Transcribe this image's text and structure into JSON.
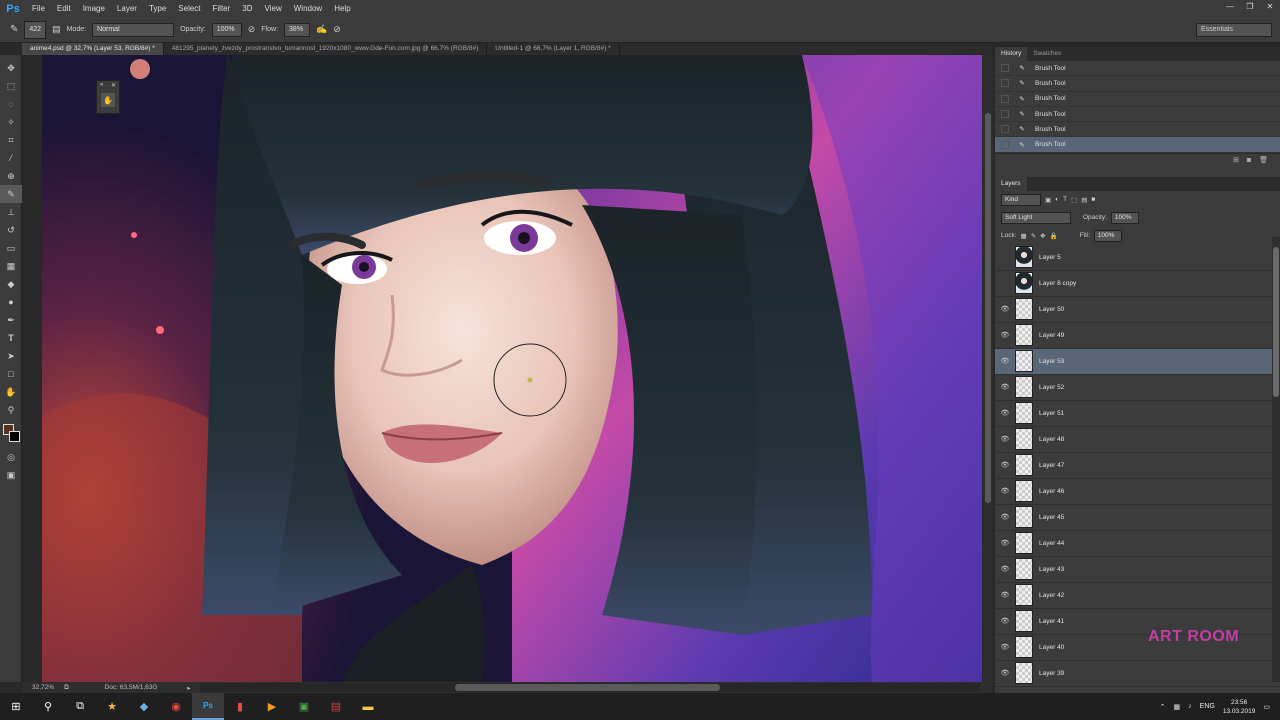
{
  "app": {
    "logo": "Ps"
  },
  "menu": [
    "File",
    "Edit",
    "Image",
    "Layer",
    "Type",
    "Select",
    "Filter",
    "3D",
    "View",
    "Window",
    "Help"
  ],
  "options": {
    "brush_size": "422",
    "mode_label": "Mode:",
    "mode_value": "Normal",
    "opacity_label": "Opacity:",
    "opacity_value": "100%",
    "flow_label": "Flow:",
    "flow_value": "38%",
    "workspace": "Essentials"
  },
  "tabs": [
    "anime4.psd @ 32,7% (Layer 53, RGB/8#) *",
    "481295_planety_zvezdy_prostranstvo_tumannost_1920x1080_www.Gde-Fon.com.jpg @ 66,7% (RGB/8#)",
    "Untitled-1 @ 66,7% (Layer 1, RGB/8#) *"
  ],
  "status": {
    "zoom": "32,72%",
    "doc": "Doc: 63,5M/1,63G"
  },
  "history": {
    "tabs": [
      "History",
      "Swatches"
    ],
    "items": [
      "Brush Tool",
      "Brush Tool",
      "Brush Tool",
      "Brush Tool",
      "Brush Tool",
      "Brush Tool"
    ]
  },
  "layers_panel": {
    "title": "Layers",
    "kind": "Kind",
    "blend_mode": "Soft Light",
    "opacity_label": "Opacity:",
    "opacity_value": "100%",
    "lock_label": "Lock:",
    "fill_label": "Fill:",
    "fill_value": "100%",
    "layers": [
      {
        "name": "Layer 5",
        "visible": false,
        "thumb": "portrait"
      },
      {
        "name": "Layer 8 copy",
        "visible": false,
        "thumb": "portrait"
      },
      {
        "name": "Layer 50",
        "visible": true,
        "thumb": "blank"
      },
      {
        "name": "Layer 49",
        "visible": true,
        "thumb": "blank"
      },
      {
        "name": "Layer 53",
        "visible": true,
        "thumb": "blank",
        "active": true
      },
      {
        "name": "Layer 52",
        "visible": true,
        "thumb": "blank"
      },
      {
        "name": "Layer 51",
        "visible": true,
        "thumb": "blank"
      },
      {
        "name": "Layer 48",
        "visible": true,
        "thumb": "blank"
      },
      {
        "name": "Layer 47",
        "visible": true,
        "thumb": "blank"
      },
      {
        "name": "Layer 46",
        "visible": true,
        "thumb": "blank"
      },
      {
        "name": "Layer 45",
        "visible": true,
        "thumb": "blank"
      },
      {
        "name": "Layer 44",
        "visible": true,
        "thumb": "blank"
      },
      {
        "name": "Layer 43",
        "visible": true,
        "thumb": "blank"
      },
      {
        "name": "Layer 42",
        "visible": true,
        "thumb": "blank"
      },
      {
        "name": "Layer 41",
        "visible": true,
        "thumb": "blank"
      },
      {
        "name": "Layer 40",
        "visible": true,
        "thumb": "blank"
      },
      {
        "name": "Layer 39",
        "visible": true,
        "thumb": "blank"
      }
    ]
  },
  "taskbar": {
    "lang": "ENG",
    "time": "23:56",
    "date": "13.03.2019"
  },
  "watermark": "ART ROOM",
  "colors": {
    "foreground": "#5a2e22",
    "background": "#000000",
    "accent": "#596678"
  }
}
